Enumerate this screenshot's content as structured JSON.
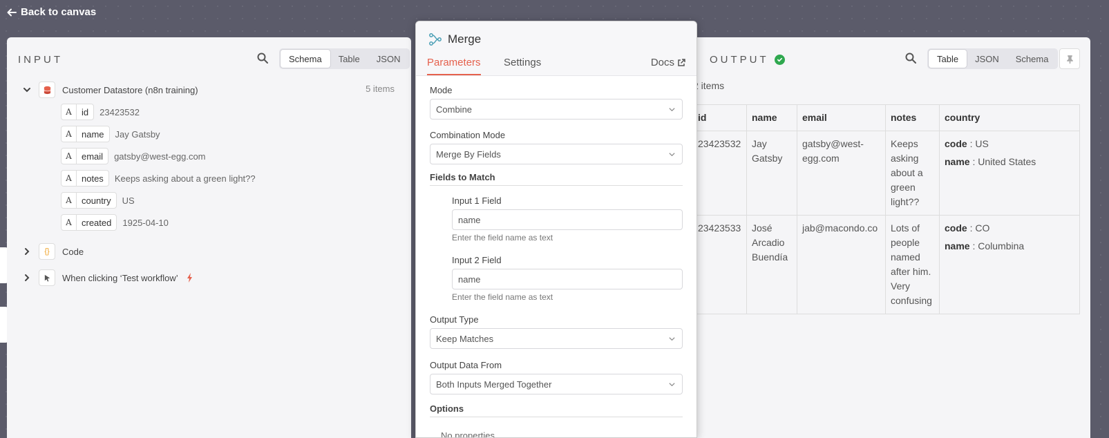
{
  "back_link": "Back to canvas",
  "input": {
    "title": "INPUT",
    "tabs": [
      "Schema",
      "Table",
      "JSON"
    ],
    "active_tab": "Schema",
    "source_node": "Customer Datastore (n8n training)",
    "item_count": "5 items",
    "fields": [
      {
        "type": "A",
        "key": "id",
        "value": "23423532"
      },
      {
        "type": "A",
        "key": "name",
        "value": "Jay Gatsby"
      },
      {
        "type": "A",
        "key": "email",
        "value": "gatsby@west-egg.com"
      },
      {
        "type": "A",
        "key": "notes",
        "value": "Keeps asking about a green light??"
      },
      {
        "type": "A",
        "key": "country",
        "value": "US"
      },
      {
        "type": "A",
        "key": "created",
        "value": "1925-04-10"
      }
    ],
    "other_nodes": [
      {
        "label": "Code",
        "icon": "{}"
      },
      {
        "label": "When clicking ‘Test workflow’"
      }
    ]
  },
  "merge": {
    "title": "Merge",
    "tabs": {
      "parameters": "Parameters",
      "settings": "Settings"
    },
    "docs": "Docs",
    "mode_label": "Mode",
    "mode_value": "Combine",
    "combination_label": "Combination Mode",
    "combination_value": "Merge By Fields",
    "fields_to_match_label": "Fields to Match",
    "input1_label": "Input 1 Field",
    "input1_value": "name",
    "input1_hint": "Enter the field name as text",
    "input2_label": "Input 2 Field",
    "input2_value": "name",
    "input2_hint": "Enter the field name as text",
    "output_type_label": "Output Type",
    "output_type_value": "Keep Matches",
    "output_data_label": "Output Data From",
    "output_data_value": "Both Inputs Merged Together",
    "options_label": "Options",
    "no_properties": "No properties"
  },
  "output": {
    "title": "OUTPUT",
    "tabs": [
      "Table",
      "JSON",
      "Schema"
    ],
    "active_tab": "Table",
    "item_count": "2 items",
    "columns": [
      "id",
      "name",
      "email",
      "notes",
      "country"
    ],
    "rows": [
      {
        "id": "23423532",
        "name": "Jay Gatsby",
        "email": "gatsby@west-egg.com",
        "notes": "Keeps asking about a green light??",
        "country_code_key": "code",
        "country_code": "US",
        "country_name_key": "name",
        "country_name": "United States"
      },
      {
        "id": "23423533",
        "name": "José Arcadio Buendía",
        "email": "jab@macondo.co",
        "notes": "Lots of people named after him. Very confusing",
        "country_code_key": "code",
        "country_code": "CO",
        "country_name_key": "name",
        "country_name": "Columbina"
      }
    ]
  },
  "colors": {
    "accent": "#e5614d",
    "success": "#2fa84f",
    "canvas": "#5b5b6a"
  }
}
